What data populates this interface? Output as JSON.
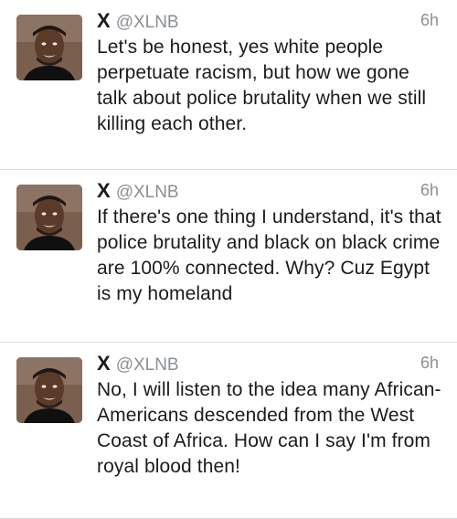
{
  "tweets": [
    {
      "name": "X",
      "handle": "@XLNB",
      "time": "6h",
      "text": "Let's be honest, yes white people perpetuate racism, but how we gone talk about police brutality when we still killing each other."
    },
    {
      "name": "X",
      "handle": "@XLNB",
      "time": "6h",
      "text": "If there's one thing I understand, it's that police brutality and black on black crime are 100% connected. Why? Cuz Egypt is my homeland"
    },
    {
      "name": "X",
      "handle": "@XLNB",
      "time": "6h",
      "text": "No, I will listen to the idea many African-Americans descended from the West Coast of Africa. How can I say I'm from royal blood then!"
    }
  ],
  "colors": {
    "text": "#1b1b1b",
    "secondary": "#8a8f94",
    "divider": "#d9d9d9"
  },
  "icons": [
    "profile-avatar"
  ]
}
